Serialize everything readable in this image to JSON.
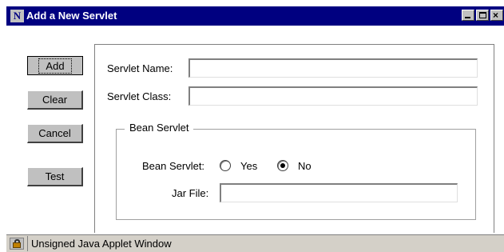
{
  "window": {
    "app_icon_letter": "N",
    "title": "Add a New Servlet",
    "close_glyph": "×"
  },
  "buttons": {
    "add": "Add",
    "clear": "Clear",
    "cancel": "Cancel",
    "test": "Test"
  },
  "form": {
    "servlet_name_label": "Servlet Name:",
    "servlet_name_value": "",
    "servlet_class_label": "Servlet Class:",
    "servlet_class_value": "",
    "bean_group_label": "Bean Servlet",
    "bean_servlet_label": "Bean Servlet:",
    "yes_label": "Yes",
    "no_label": "No",
    "selected_option": "No",
    "jar_file_label": "Jar File:",
    "jar_file_value": ""
  },
  "status": {
    "text": "Unsigned Java Applet Window"
  },
  "colors": {
    "titlebar": "#000080",
    "chrome": "#c0c0c0"
  }
}
